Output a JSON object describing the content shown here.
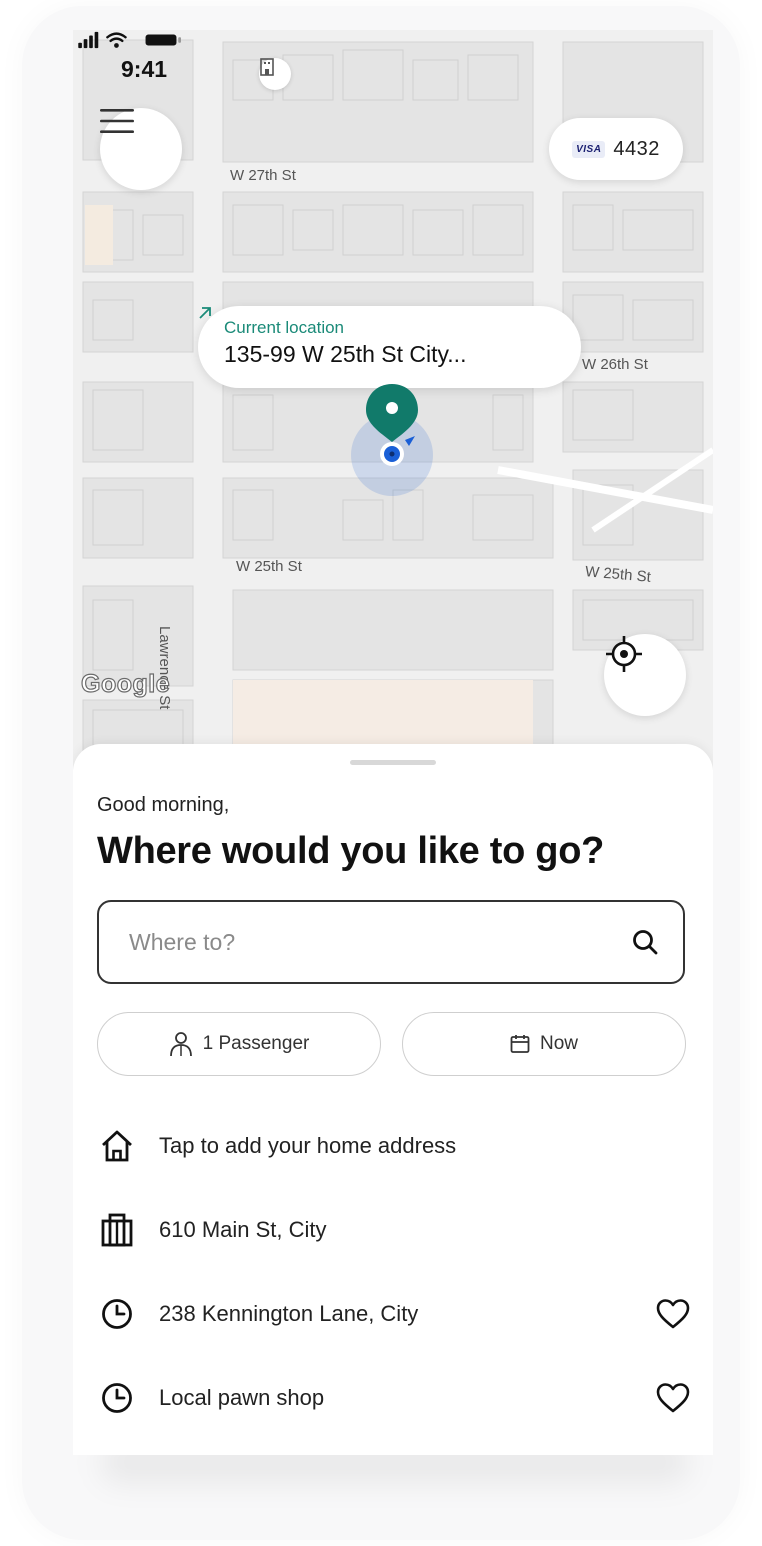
{
  "status_bar": {
    "time": "9:41"
  },
  "payment": {
    "brand": "VISA",
    "last4": "4432"
  },
  "map": {
    "current_location_label": "Current location",
    "current_address": "135-99 W 25th St City...",
    "streets": {
      "w27": "W 27th St",
      "w26": "W 26th St",
      "w25_left": "W 25th St",
      "w25_right": "W 25th St",
      "lawrence": "Lawrence St"
    },
    "attribution": "Google",
    "accent_color": "#117a6a",
    "user_dot_color": "#1a5fd6"
  },
  "sheet": {
    "greeting": "Good morning,",
    "headline": "Where would you like to go?",
    "search": {
      "placeholder": "Where to?",
      "value": ""
    },
    "chips": {
      "passengers": "1 Passenger",
      "time": "Now"
    },
    "destinations": [
      {
        "icon": "home-icon",
        "label": "Tap to add your home address"
      },
      {
        "icon": "building-icon",
        "label": "610 Main St, City"
      },
      {
        "icon": "clock-icon",
        "label": "238 Kennington Lane, City",
        "favorite": true
      },
      {
        "icon": "clock-icon",
        "label": "Local pawn shop",
        "favorite": true
      }
    ]
  }
}
